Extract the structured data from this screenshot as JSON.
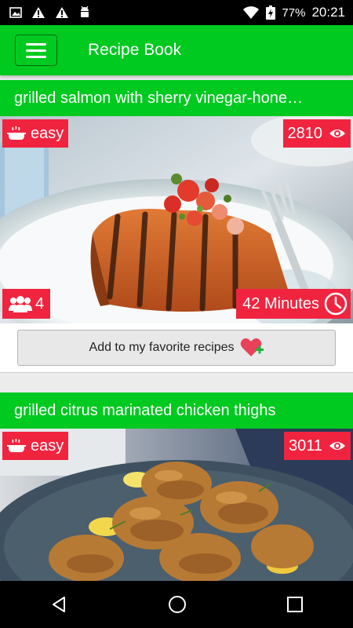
{
  "status_bar": {
    "icons_left": [
      "image-icon",
      "warning-icon",
      "warning-icon",
      "android-icon"
    ],
    "battery": "77%",
    "time": "20:21"
  },
  "app_bar": {
    "title": "Recipe Book"
  },
  "recipes": [
    {
      "title": "grilled salmon with sherry vinegar-hone…",
      "difficulty": "easy",
      "views": "2810",
      "servings": "4",
      "time": "42 Minutes",
      "favorite_label": "Add to my favorite recipes"
    },
    {
      "title": "grilled citrus marinated chicken thighs",
      "difficulty": "easy",
      "views": "3011"
    }
  ],
  "colors": {
    "primary": "#00c91f",
    "badge": "#f0243f",
    "heart": "#e8425a",
    "plus": "#1fb33a"
  }
}
